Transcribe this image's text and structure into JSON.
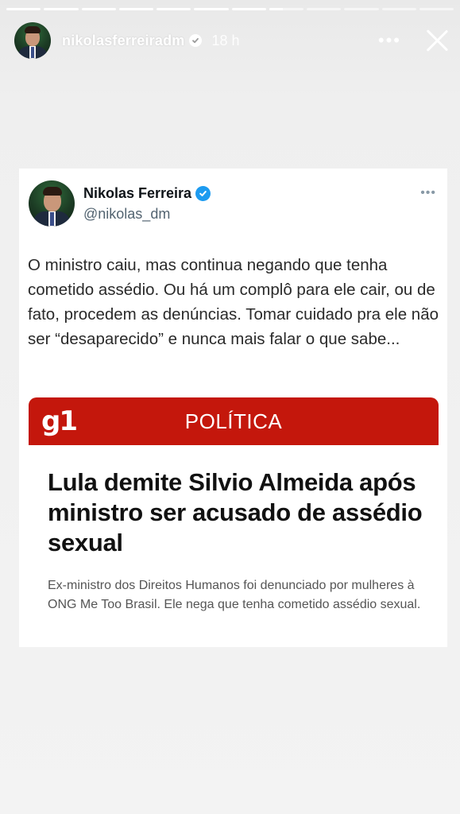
{
  "story": {
    "progress": [
      1,
      1,
      1,
      1,
      1,
      1,
      1,
      0.4,
      0,
      0,
      0,
      0
    ],
    "username": "nikolasferreiradm",
    "time": "18 h",
    "more_glyph": "•••",
    "icons": {
      "verified": "verified-badge-icon",
      "more": "more-icon",
      "close": "close-icon"
    }
  },
  "tweet": {
    "name": "Nikolas Ferreira",
    "handle": "@nikolas_dm",
    "more_glyph": "•••",
    "text": "O ministro caiu, mas continua negando que tenha cometido assédio. Ou há um complô para ele cair, ou de fato, procedem as denúncias. Tomar cuidado pra ele não ser “desaparecido” e nunca mais falar o que sabe...",
    "colors": {
      "verified": "#1d9bf0"
    }
  },
  "article": {
    "logo": "g1",
    "section": "POLÍTICA",
    "headline": "Lula demite Silvio Almeida após ministro ser acusado de assédio sexual",
    "subtitle": "Ex-ministro dos Direitos Humanos foi denunciado por mulheres à ONG Me Too Brasil. Ele nega que tenha cometido assédio sexual.",
    "colors": {
      "brand": "#c4170c"
    }
  }
}
